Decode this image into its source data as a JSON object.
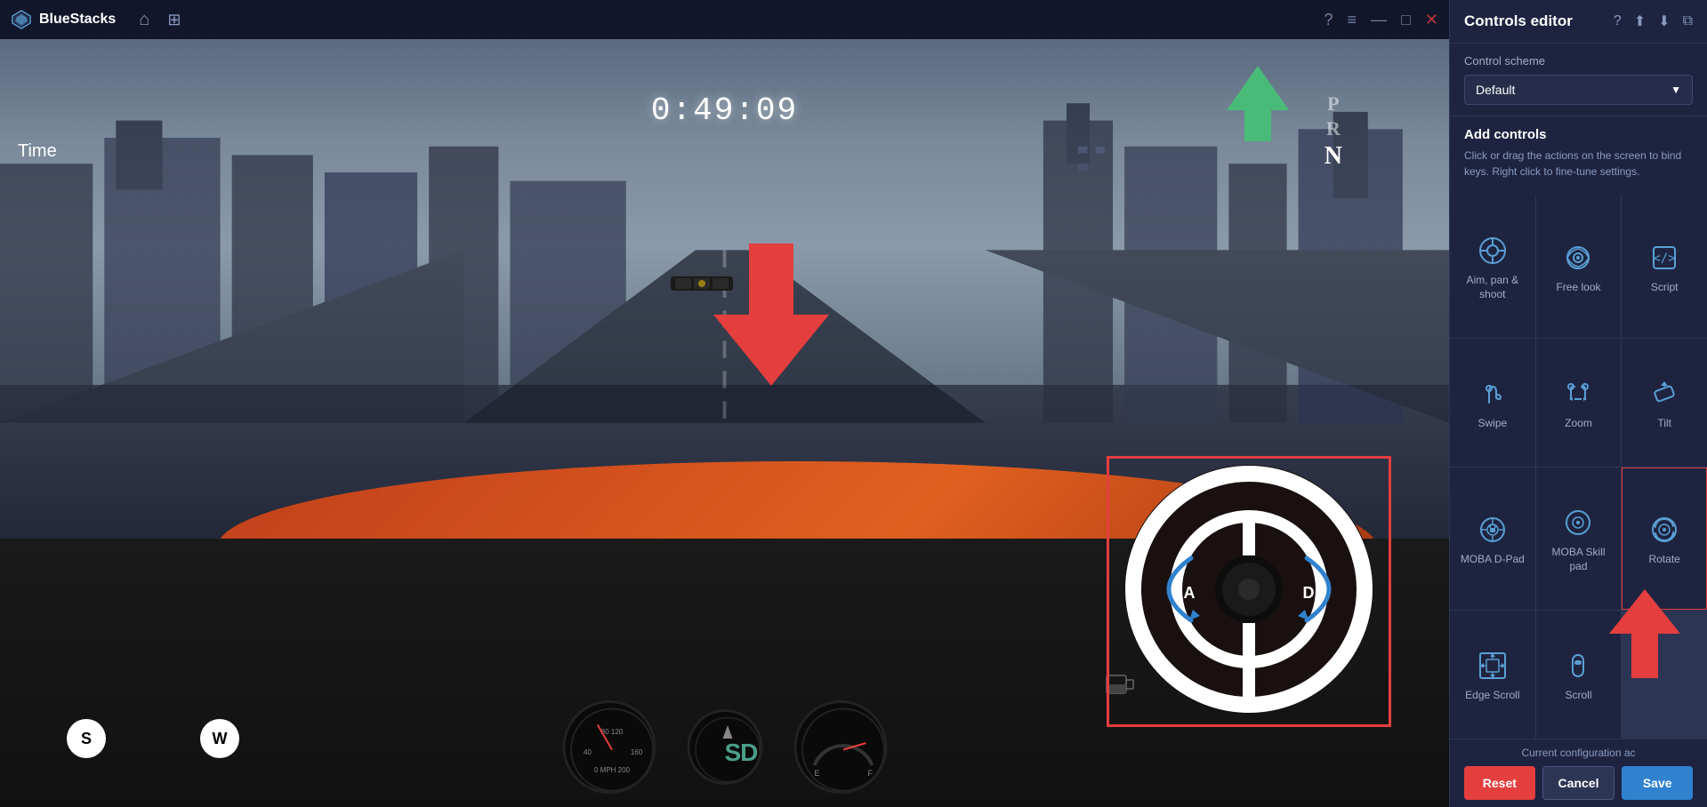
{
  "app": {
    "title": "BlueStacks",
    "logo_text": "BlueStacks"
  },
  "topbar": {
    "home_icon": "⌂",
    "menu_icon": "☰",
    "minimize_icon": "—",
    "maximize_icon": "□",
    "close_icon": "✕",
    "help_icon": "?",
    "hamburger_icon": "≡"
  },
  "game": {
    "timer": "0:49:09",
    "time_label": "Time",
    "gear_p": "P",
    "gear_r": "R",
    "gear_n": "N",
    "key_s": "S",
    "key_w": "W",
    "sd_text": "SD"
  },
  "editor": {
    "title": "Controls editor",
    "help_icon": "?",
    "import_icon": "↑",
    "export_icon": "↓",
    "save_as_icon": "□",
    "scheme_label": "Control scheme",
    "scheme_value": "Default",
    "add_controls_title": "Add controls",
    "add_controls_desc": "Click or drag the actions on the screen to bind keys. Right click to fine-tune settings.",
    "controls": [
      {
        "id": "aim-pan-shoot",
        "label": "Aim, pan & shoot",
        "icon_type": "aim"
      },
      {
        "id": "free-look",
        "label": "Free look",
        "icon_type": "eye"
      },
      {
        "id": "script",
        "label": "Script",
        "icon_type": "code"
      },
      {
        "id": "swipe",
        "label": "Swipe",
        "icon_type": "swipe"
      },
      {
        "id": "zoom",
        "label": "Zoom",
        "icon_type": "zoom"
      },
      {
        "id": "tilt",
        "label": "Tilt",
        "icon_type": "tilt"
      },
      {
        "id": "moba-dpad",
        "label": "MOBA D-Pad",
        "icon_type": "moba-dpad"
      },
      {
        "id": "moba-skill-pad",
        "label": "MOBA Skill pad",
        "icon_type": "moba-skill"
      },
      {
        "id": "rotate",
        "label": "Rotate",
        "icon_type": "rotate",
        "selected": true
      },
      {
        "id": "edge-scroll",
        "label": "Edge Scroll",
        "icon_type": "edge-scroll"
      },
      {
        "id": "scroll",
        "label": "Scroll",
        "icon_type": "scroll"
      }
    ],
    "current_config_text": "Current configuration ac",
    "btn_reset": "Reset",
    "btn_cancel": "Cancel",
    "btn_save": "Save"
  },
  "colors": {
    "accent_blue": "#3182ce",
    "accent_red": "#e53e3e",
    "accent_green": "#48bb78",
    "icon_blue": "#5a9fd4",
    "bg_dark": "#1e2440",
    "bg_darker": "#161b30",
    "text_primary": "#ffffff",
    "text_secondary": "#a0aec0",
    "text_muted": "#8a9bc0",
    "border": "#2d3555"
  }
}
